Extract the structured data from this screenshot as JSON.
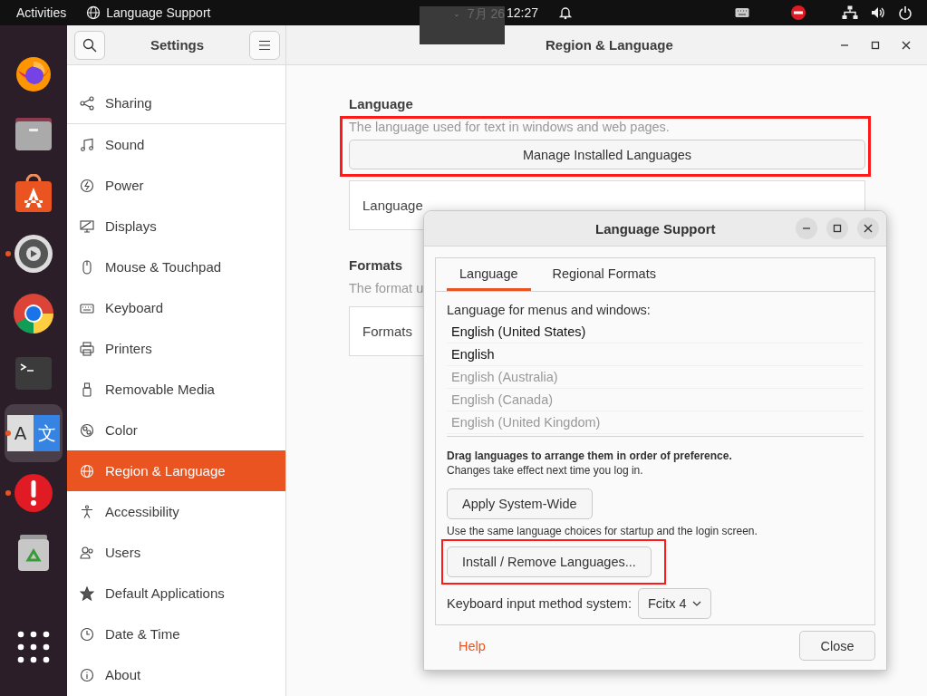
{
  "top_bar": {
    "activities": "Activities",
    "app_menu": "Language Support",
    "date": "7月 26",
    "clock": "12:27"
  },
  "dock": [
    {
      "kind": "firefox",
      "running": false,
      "selected": false
    },
    {
      "kind": "files",
      "running": false,
      "selected": false
    },
    {
      "kind": "store",
      "running": false,
      "selected": false
    },
    {
      "kind": "settings",
      "running": true,
      "selected": false
    },
    {
      "kind": "chrome",
      "running": false,
      "selected": false
    },
    {
      "kind": "terminal",
      "running": false,
      "selected": false
    },
    {
      "kind": "language",
      "running": true,
      "selected": true,
      "glyphs": [
        "A",
        "文"
      ]
    },
    {
      "kind": "alert",
      "running": true,
      "selected": false
    },
    {
      "kind": "trash",
      "running": false,
      "selected": false
    },
    {
      "kind": "grid",
      "running": false,
      "selected": false
    }
  ],
  "settings": {
    "title": "Settings",
    "page_title": "Region & Language",
    "sidebar": [
      {
        "label": "Sharing",
        "kind": "share",
        "selected": false
      },
      {
        "label": "Sound",
        "kind": "note",
        "selected": false
      },
      {
        "label": "Power",
        "kind": "power",
        "selected": false
      },
      {
        "label": "Displays",
        "kind": "display",
        "selected": false
      },
      {
        "label": "Mouse & Touchpad",
        "kind": "mouse",
        "selected": false
      },
      {
        "label": "Keyboard",
        "kind": "keyboard",
        "selected": false
      },
      {
        "label": "Printers",
        "kind": "printer",
        "selected": false
      },
      {
        "label": "Removable Media",
        "kind": "usb",
        "selected": false
      },
      {
        "label": "Color",
        "kind": "color",
        "selected": false
      },
      {
        "label": "Region & Language",
        "kind": "globe",
        "selected": true
      },
      {
        "label": "Accessibility",
        "kind": "person",
        "selected": false
      },
      {
        "label": "Users",
        "kind": "users",
        "selected": false
      },
      {
        "label": "Default Applications",
        "kind": "star",
        "selected": false
      },
      {
        "label": "Date & Time",
        "kind": "clock",
        "selected": false
      },
      {
        "label": "About",
        "kind": "info",
        "selected": false
      }
    ],
    "language_section": {
      "heading": "Language",
      "description": "The language used for text in windows and web pages.",
      "manage_button": "Manage Installed Languages",
      "highlighted": true,
      "row_label": "Language"
    },
    "formats_section": {
      "heading": "Formats",
      "description": "The format u",
      "row_label": "Formats"
    }
  },
  "dialog": {
    "title": "Language Support",
    "tabs": [
      {
        "label": "Language",
        "selected": true
      },
      {
        "label": "Regional Formats",
        "selected": false
      }
    ],
    "list_label": "Language for menus and windows:",
    "languages": [
      {
        "name": "English (United States)",
        "enabled": true
      },
      {
        "name": "English",
        "enabled": true
      },
      {
        "name": "English (Australia)",
        "enabled": false
      },
      {
        "name": "English (Canada)",
        "enabled": false
      },
      {
        "name": "English (United Kingdom)",
        "enabled": false
      }
    ],
    "drag_hint": "Drag languages to arrange them in order of preference.",
    "change_note": "Changes take effect next time you log in.",
    "apply_button": "Apply System-Wide",
    "same_note": "Use the same language choices for startup and the login screen.",
    "install_button": {
      "label": "Install / Remove Languages...",
      "highlighted": true
    },
    "input_label": "Keyboard input method system:",
    "input_value": "Fcitx 4",
    "help": "Help",
    "close": "Close"
  }
}
